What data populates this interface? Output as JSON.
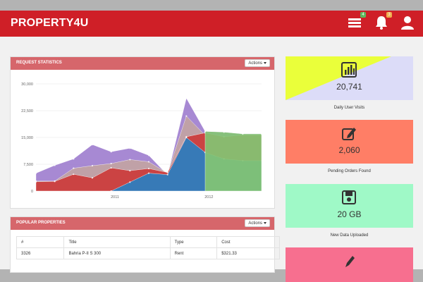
{
  "app": {
    "brand": "PROPERTY4U"
  },
  "topbar": {
    "messages_badge": "4",
    "notifications_badge": "3"
  },
  "request_statistics": {
    "title": "REQUEST STATISTICS",
    "actions_label": "Actions"
  },
  "popular_properties": {
    "title": "POPULAR PROPERTIES",
    "actions_label": "Actions",
    "columns": [
      "#",
      "Title",
      "Type",
      "Cost"
    ],
    "rows": [
      [
        "3326",
        "Bahria P-II S 300",
        "Rent",
        "$321.33"
      ]
    ]
  },
  "stats": [
    {
      "value": "20,741",
      "label": "Daily User Visits",
      "icon": "bar-chart-icon",
      "color": "#dcdcf8",
      "accent": "#eaff3a"
    },
    {
      "value": "2,060",
      "label": "Pending Orders Found",
      "icon": "edit-icon",
      "color": "#ff7e66"
    },
    {
      "value": "20 GB",
      "label": "New Data Uploaded",
      "icon": "save-icon",
      "color": "#9ff9c7"
    },
    {
      "value": "",
      "label": "",
      "icon": "pencil-icon",
      "color": "#f76f8f"
    }
  ],
  "chart_data": {
    "type": "area",
    "x": [
      0,
      1,
      2,
      3,
      4,
      5,
      6,
      7,
      8,
      9,
      10,
      11,
      12
    ],
    "x_tick_labels": [
      {
        "at": 4.2,
        "label": "2011"
      },
      {
        "at": 9.2,
        "label": "2012"
      }
    ],
    "ylim": [
      0,
      30000
    ],
    "y_ticks": [
      0,
      7500,
      15000,
      22500,
      30000
    ],
    "y_tick_labels": [
      "0",
      "7,500",
      "15,000",
      "22,500",
      "30,000"
    ],
    "grid": true,
    "series": [
      {
        "values": [
          2600,
          2700,
          4700,
          3700,
          6500,
          5700,
          6300,
          5200,
          15200,
          16300,
          15200,
          15700,
          15700
        ],
        "color": "#cc3b3b"
      },
      {
        "values": [
          2800,
          2800,
          6400,
          7100,
          7700,
          8800,
          8200,
          5000,
          21000,
          15600,
          15200,
          15700,
          15700
        ],
        "color": "#c2a3a3"
      },
      {
        "values": [
          5000,
          7200,
          9000,
          13000,
          11000,
          12000,
          10000,
          4500,
          26000,
          16700,
          16500,
          16000,
          16000
        ],
        "color": "#9f7fcf"
      },
      {
        "values": [
          null,
          null,
          null,
          null,
          0,
          2500,
          5000,
          4600,
          15000,
          10800,
          9000,
          8500,
          8500
        ],
        "color": "#2a7fc1"
      },
      {
        "values": [
          null,
          null,
          null,
          null,
          null,
          null,
          null,
          null,
          null,
          16700,
          16500,
          16000,
          16000
        ],
        "color": "#83c473"
      }
    ]
  }
}
